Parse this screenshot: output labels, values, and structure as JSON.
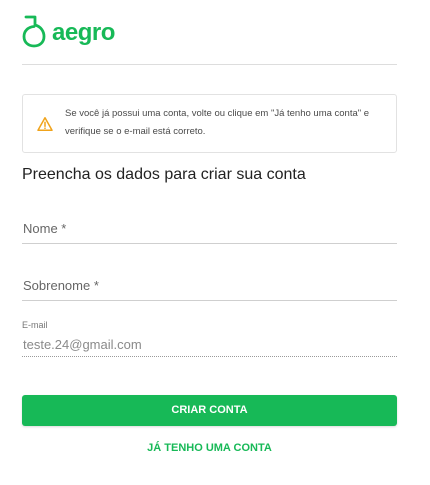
{
  "logo": {
    "text": "aegro",
    "icon": "aegro-leaf-logo",
    "color": "#17b957"
  },
  "alert": {
    "icon": "warning-icon",
    "icon_color": "#f0a31b",
    "message": "Se você já possui uma conta, volte ou clique em \"Já tenho uma conta\" e verifique se o e-mail está correto."
  },
  "form": {
    "heading": "Preencha os dados para criar sua conta",
    "name_placeholder": "Nome *",
    "surname_placeholder": "Sobrenome *",
    "email_label": "E-mail",
    "email_value": "teste.24@gmail.com"
  },
  "actions": {
    "create_label": "CRIAR CONTA",
    "have_account_label": "JÁ TENHO UMA CONTA",
    "accent_color": "#17b957"
  }
}
